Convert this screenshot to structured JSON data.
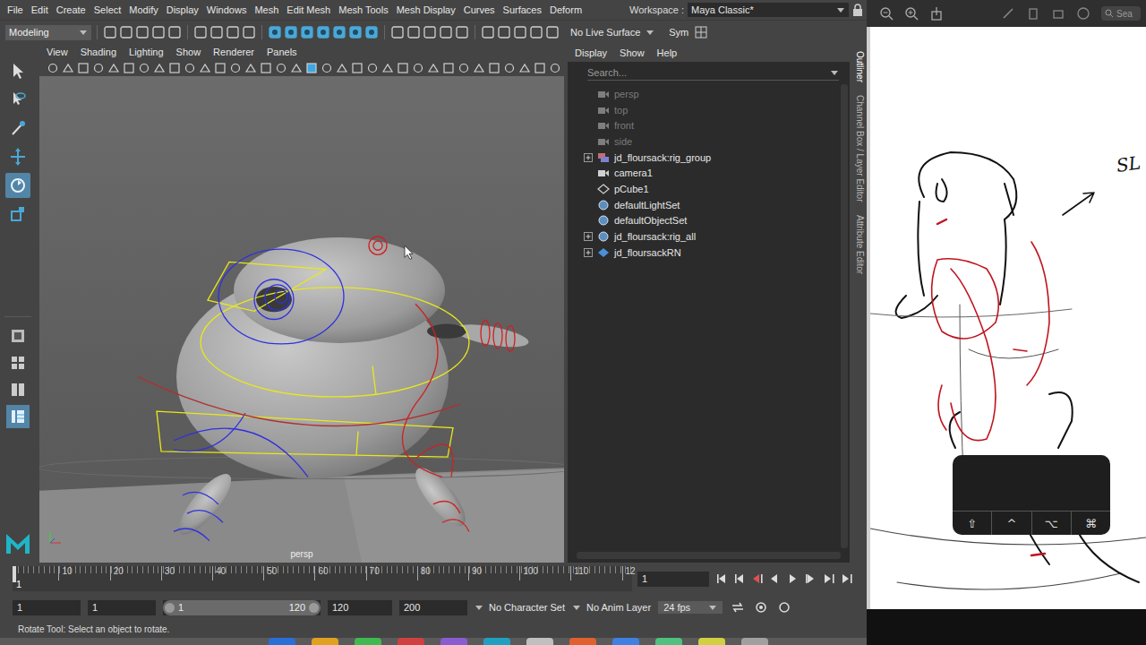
{
  "menu_bar": {
    "items": [
      "File",
      "Edit",
      "Create",
      "Select",
      "Modify",
      "Display",
      "Windows",
      "Mesh",
      "Edit Mesh",
      "Mesh Tools",
      "Mesh Display",
      "Curves",
      "Surfaces",
      "Deform"
    ],
    "workspace_label": "Workspace :",
    "workspace": "Maya Classic*"
  },
  "status_line": {
    "menu_set": "Modeling",
    "live_surface": "No Live Surface",
    "symmetry": "Sym"
  },
  "toolbox": {
    "tools": [
      {
        "kind": "select",
        "selected": false
      },
      {
        "kind": "lasso",
        "selected": false
      },
      {
        "kind": "paint",
        "selected": false
      },
      {
        "kind": "move",
        "selected": false
      },
      {
        "kind": "rotate",
        "selected": true
      },
      {
        "kind": "scale",
        "selected": false
      }
    ],
    "layouts": [
      {
        "kind": "single",
        "selected": false
      },
      {
        "kind": "four",
        "selected": false
      },
      {
        "kind": "split",
        "selected": false
      },
      {
        "kind": "outliner",
        "selected": true
      }
    ]
  },
  "viewport": {
    "menu": [
      "View",
      "Shading",
      "Lighting",
      "Show",
      "Renderer",
      "Panels"
    ],
    "camera": "persp"
  },
  "outliner": {
    "menu": [
      "Display",
      "Show",
      "Help"
    ],
    "search_placeholder": "Search...",
    "items": [
      {
        "label": "persp",
        "kind": "camera",
        "dimmed": true,
        "expandable": false
      },
      {
        "label": "top",
        "kind": "camera",
        "dimmed": true,
        "expandable": false
      },
      {
        "label": "front",
        "kind": "camera",
        "dimmed": true,
        "expandable": false
      },
      {
        "label": "side",
        "kind": "camera",
        "dimmed": true,
        "expandable": false
      },
      {
        "label": "jd_floursack:rig_group",
        "kind": "group",
        "dimmed": false,
        "expandable": true
      },
      {
        "label": "camera1",
        "kind": "camera",
        "dimmed": false,
        "expandable": false
      },
      {
        "label": "pCube1",
        "kind": "transform",
        "dimmed": false,
        "expandable": false
      },
      {
        "label": "defaultLightSet",
        "kind": "set",
        "dimmed": false,
        "expandable": false
      },
      {
        "label": "defaultObjectSet",
        "kind": "set",
        "dimmed": false,
        "expandable": false
      },
      {
        "label": "jd_floursack:rig_all",
        "kind": "set",
        "dimmed": false,
        "expandable": true
      },
      {
        "label": "jd_floursackRN",
        "kind": "reference",
        "dimmed": false,
        "expandable": true
      }
    ]
  },
  "side_tabs": [
    {
      "label": "Outliner",
      "selected": true
    },
    {
      "label": "Channel Box / Layer Editor",
      "selected": false
    },
    {
      "label": "Attribute Editor",
      "selected": false
    }
  ],
  "time_slider": {
    "current_frame": "1",
    "ticks": [
      "10",
      "20",
      "30",
      "40",
      "50",
      "60",
      "70",
      "80",
      "90",
      "100",
      "110",
      "12"
    ],
    "frame_field": "1",
    "playback": [
      "first",
      "prev-frame",
      "prev-key",
      "play-back",
      "play",
      "next-key",
      "next-frame",
      "last"
    ]
  },
  "range_slider": {
    "start": "1",
    "playback_start": "1",
    "handle_start": "1",
    "handle_end": "120",
    "playback_end": "120",
    "end": "200",
    "level": 1
  },
  "character_set": "No Character Set",
  "anim_layer": "No Anim Layer",
  "fps": "24 fps",
  "help_line": "Rotate Tool: Select an object to rotate.",
  "sketch_app": {
    "search_placeholder": "Sea",
    "annotation": "SL",
    "modifier_keys": [
      "⇧",
      "^",
      "⌥",
      "⌘"
    ]
  }
}
